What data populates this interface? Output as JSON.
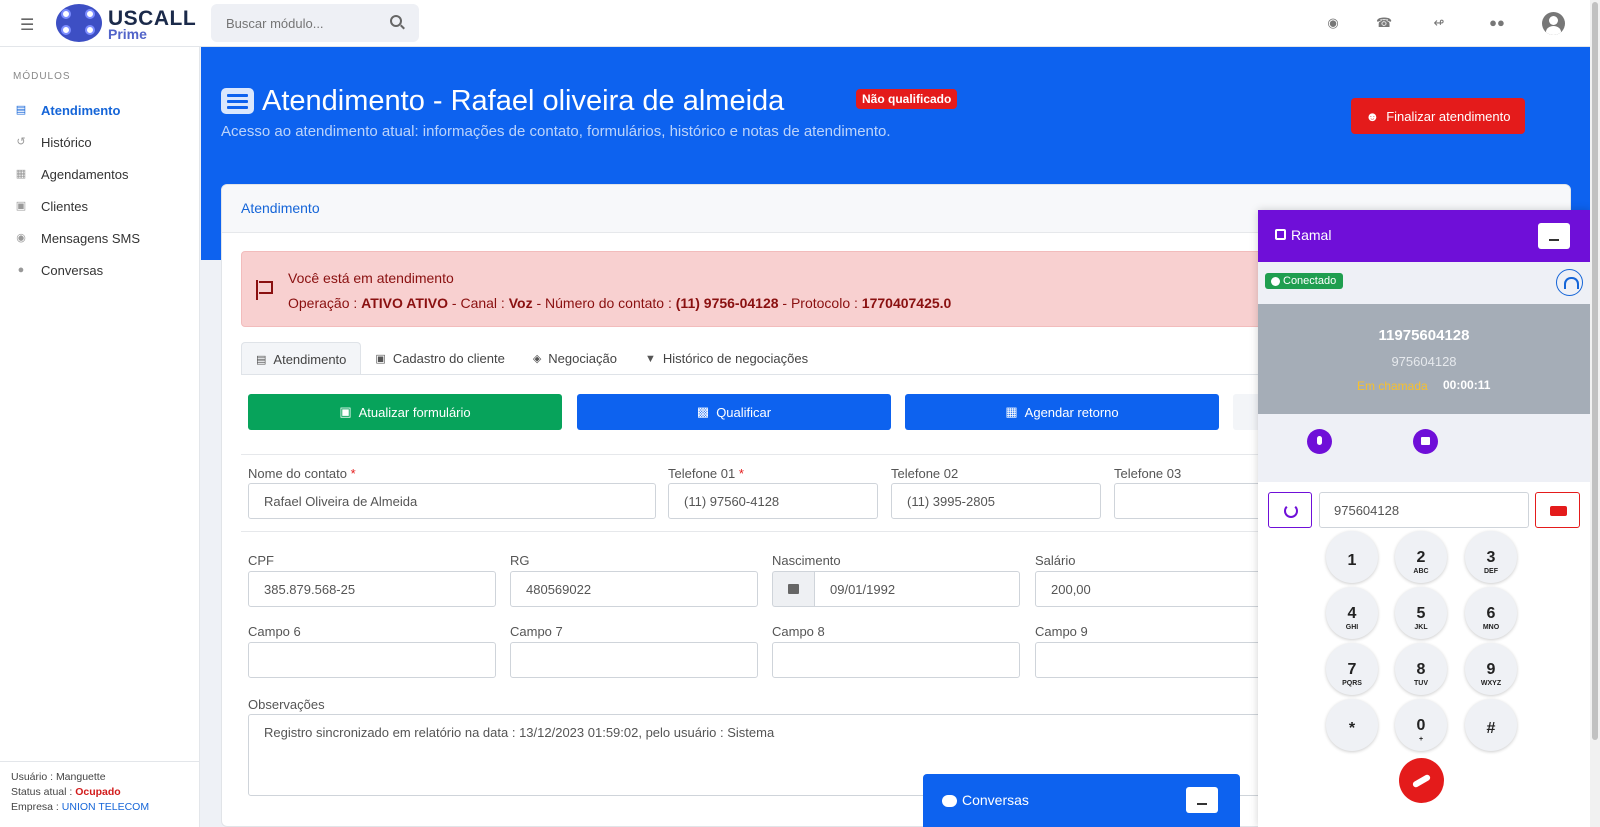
{
  "app": {
    "brand_title": "USCALL",
    "brand_sub": "Prime",
    "search_placeholder": "Buscar módulo..."
  },
  "sidebar": {
    "section_title": "MÓDULOS",
    "items": [
      {
        "label": "Atendimento",
        "icon": "list-icon",
        "active": true
      },
      {
        "label": "Histórico",
        "icon": "history-icon"
      },
      {
        "label": "Agendamentos",
        "icon": "calendar-icon"
      },
      {
        "label": "Clientes",
        "icon": "contact-book-icon"
      },
      {
        "label": "Mensagens SMS",
        "icon": "message-icon"
      },
      {
        "label": "Conversas",
        "icon": "chat-icon"
      }
    ],
    "footer": {
      "user_label": "Usuário : ",
      "user_value": "Manguette",
      "status_label": "Status atual : ",
      "status_value": "Ocupado",
      "company_label": "Empresa : ",
      "company_value": "UNION TELECOM"
    }
  },
  "header": {
    "title": "Atendimento - Rafael oliveira de almeida",
    "badge": "Não qualificado",
    "subtitle": "Acesso ao atendimento atual: informações de contato, formulários, histórico e notas de atendimento.",
    "finalize_label": "Finalizar atendimento"
  },
  "card": {
    "title": "Atendimento",
    "alert": {
      "title": "Você está em atendimento",
      "operacao_label": "Operação : ",
      "operacao_value": "ATIVO ATIVO",
      "canal_label": " - Canal : ",
      "canal_value": "Voz",
      "numero_label": " - Número do contato : ",
      "numero_value": "(11) 9756-04128",
      "protocolo_label": " - Protocolo : ",
      "protocolo_value": "1770407425.0"
    },
    "tabs": [
      {
        "label": "Atendimento",
        "active": true
      },
      {
        "label": "Cadastro do cliente"
      },
      {
        "label": "Negociação"
      },
      {
        "label": "Histórico de negociações"
      }
    ],
    "actions": {
      "update": "Atualizar formulário",
      "qualify": "Qualificar",
      "schedule": "Agendar retorno"
    },
    "fields": {
      "nome_label": "Nome do contato",
      "nome_value": "Rafael Oliveira de Almeida",
      "tel1_label": "Telefone 01",
      "tel1_value": "(11) 97560-4128",
      "tel2_label": "Telefone 02",
      "tel2_value": "(11) 3995-2805",
      "tel3_label": "Telefone 03",
      "tel3_value": "",
      "cpf_label": "CPF",
      "cpf_value": "385.879.568-25",
      "rg_label": "RG",
      "rg_value": "480569022",
      "nasc_label": "Nascimento",
      "nasc_value": "09/01/1992",
      "salario_label": "Salário",
      "salario_value": "200,00",
      "campo6_label": "Campo 6",
      "campo7_label": "Campo 7",
      "campo8_label": "Campo 8",
      "campo9_label": "Campo 9",
      "obs_label": "Observações",
      "obs_value": "Registro sincronizado em relatório na data : 13/12/2023 01:59:02, pelo usuário : Sistema"
    },
    "required_mark": "*"
  },
  "ramal": {
    "title": "Ramal",
    "status": "Conectado",
    "number": "11975604128",
    "extension": "975604128",
    "state": "Em chamada",
    "timer": "00:00:11",
    "dial_value": "975604128",
    "keys": [
      {
        "k": "1",
        "s": ""
      },
      {
        "k": "2",
        "s": "ABC"
      },
      {
        "k": "3",
        "s": "DEF"
      },
      {
        "k": "4",
        "s": "GHI"
      },
      {
        "k": "5",
        "s": "JKL"
      },
      {
        "k": "6",
        "s": "MNO"
      },
      {
        "k": "7",
        "s": "PQRS"
      },
      {
        "k": "8",
        "s": "TUV"
      },
      {
        "k": "9",
        "s": "WXYZ"
      },
      {
        "k": "*",
        "s": ""
      },
      {
        "k": "0",
        "s": "+"
      },
      {
        "k": "#",
        "s": ""
      }
    ]
  },
  "conversas": {
    "title": "Conversas"
  },
  "colors": {
    "primary": "#0d62ef",
    "ramal": "#6f0fd8",
    "danger": "#e41b1b",
    "success": "#07a35b"
  }
}
